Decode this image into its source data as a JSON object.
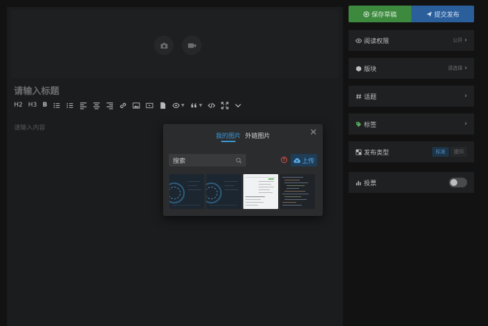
{
  "editor": {
    "title_placeholder": "请输入标题",
    "content_placeholder": "请输入内容",
    "toolbar": {
      "h2": "H2",
      "h3": "H3",
      "bold": "B"
    }
  },
  "sidebar": {
    "save_draft": "保存草稿",
    "publish": "提交发布",
    "read_permission": {
      "label": "阅读权限",
      "value": "公开"
    },
    "section": {
      "label": "版块",
      "value": "请选择"
    },
    "topic": {
      "label": "话题"
    },
    "tags": {
      "label": "标签"
    },
    "publish_type": {
      "label": "发布类型",
      "options": [
        "标准",
        "提问"
      ],
      "selected": "标准"
    },
    "vote": {
      "label": "投票",
      "enabled": false
    }
  },
  "modal": {
    "tabs": [
      "我的图片",
      "外链图片"
    ],
    "active_tab": "我的图片",
    "search_placeholder": "搜索",
    "help": "?",
    "upload": "上传",
    "thumbnail_count": 4
  },
  "colors": {
    "accent": "#3a98d8",
    "draft_green": "#3d8a3f",
    "publish_blue": "#2b5f9c",
    "help_red": "#d9534f"
  }
}
